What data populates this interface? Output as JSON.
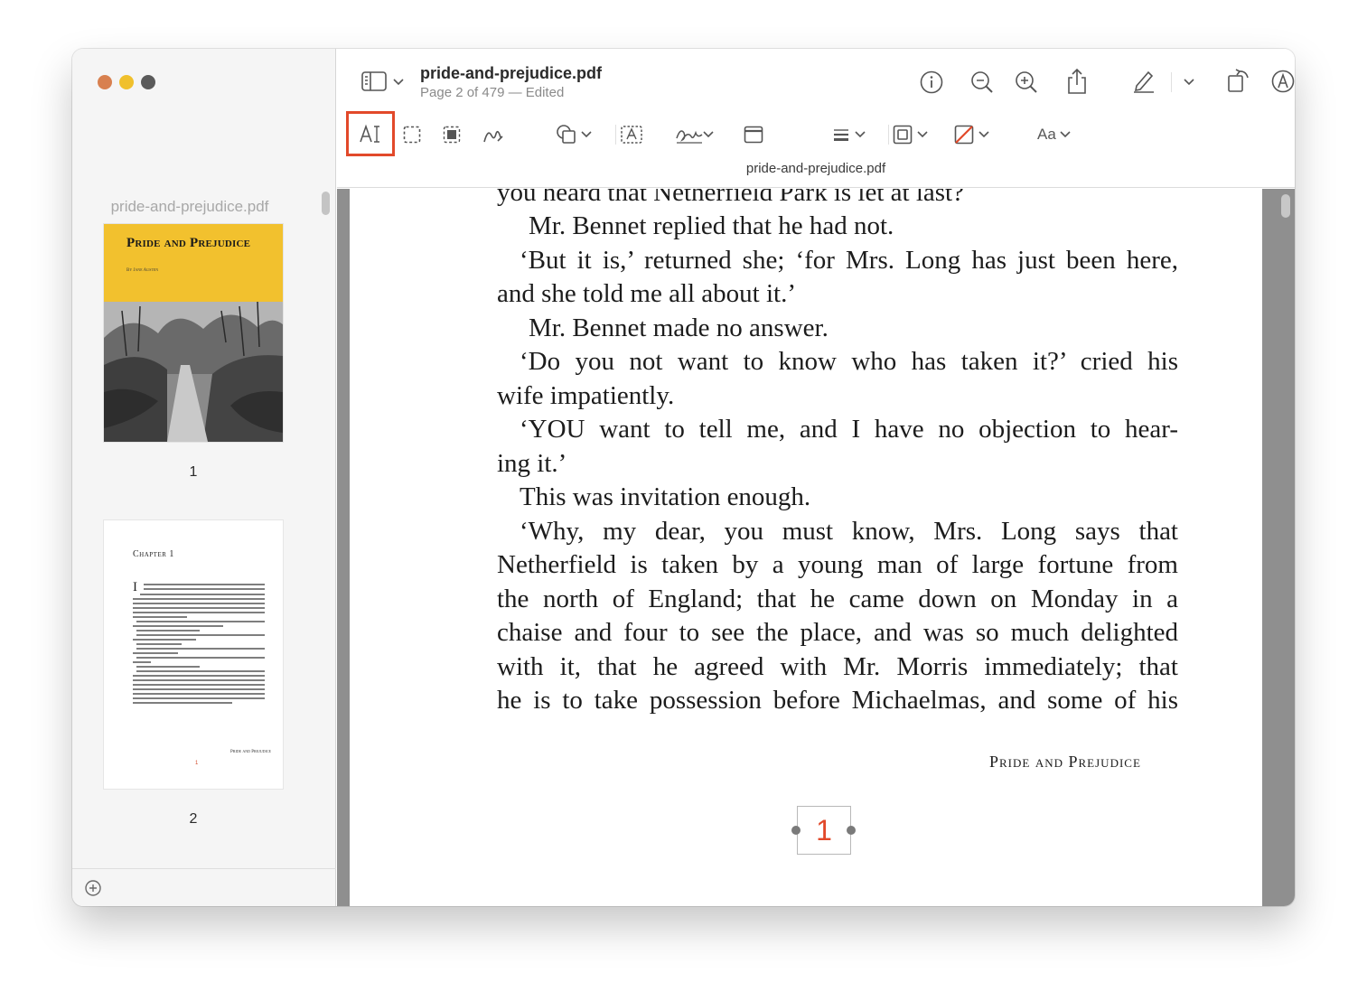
{
  "window": {
    "title": "pride-and-prejudice.pdf",
    "subtitle": "Page 2 of 479 — Edited"
  },
  "sidebar": {
    "filename": "pride-and-prejudice.pdf",
    "thumbnails": [
      {
        "page_label": "1",
        "cover_title": "Pride and Prejudice",
        "cover_author": "By Jane Austen"
      },
      {
        "page_label": "2",
        "chapter": "Chapter 1",
        "footer": "Pride and Prejudice",
        "page_number": "1"
      }
    ]
  },
  "toolbar": {
    "row1_icons": [
      "sidebar-toggle-icon",
      "info-icon",
      "zoom-out-icon",
      "zoom-in-icon",
      "share-icon",
      "highlight-pen-icon",
      "rotate-icon",
      "markup-icon",
      "search-icon"
    ],
    "row2_icons": [
      "text-selection-icon",
      "rect-selection-icon",
      "smart-lasso-icon",
      "sketch-icon",
      "shapes-icon",
      "text-box-icon",
      "signature-icon",
      "note-icon",
      "line-style-icon",
      "border-color-icon",
      "fill-color-icon"
    ],
    "font_label": "Aa",
    "active_tool": "text-selection"
  },
  "content": {
    "inline_filename": "pride-and-prejudice.pdf",
    "paragraphs": [
      "you heard that Netherfield Park is let at last?",
      "Mr. Bennet replied that he had not.",
      "‘But it is,’ returned she; ‘for Mrs. Long has just been here,",
      "and she told me all about it.’",
      "Mr. Bennet made no answer.",
      "‘Do you not want to know who has taken it?’ cried his",
      "wife impatiently.",
      "‘YOU want to tell me, and I have no objection to hear-",
      "ing it.’",
      "This was invitation enough.",
      "‘Why, my dear, you must know, Mrs. Long says that",
      "Netherfield is taken by a young man of large fortune from",
      "the north of England; that he came down on Monday in a",
      "chaise and four to see the place, and was so much delighted",
      "with it, that he agreed with Mr. Morris immediately; that",
      "he is to take possession before Michaelmas, and some of his"
    ],
    "running_head": "Pride and Prejudice",
    "page_number": "1"
  },
  "colors": {
    "accent": "#e2492a",
    "cover_yellow": "#f2c12e",
    "content_background": "#8f8f8f"
  }
}
